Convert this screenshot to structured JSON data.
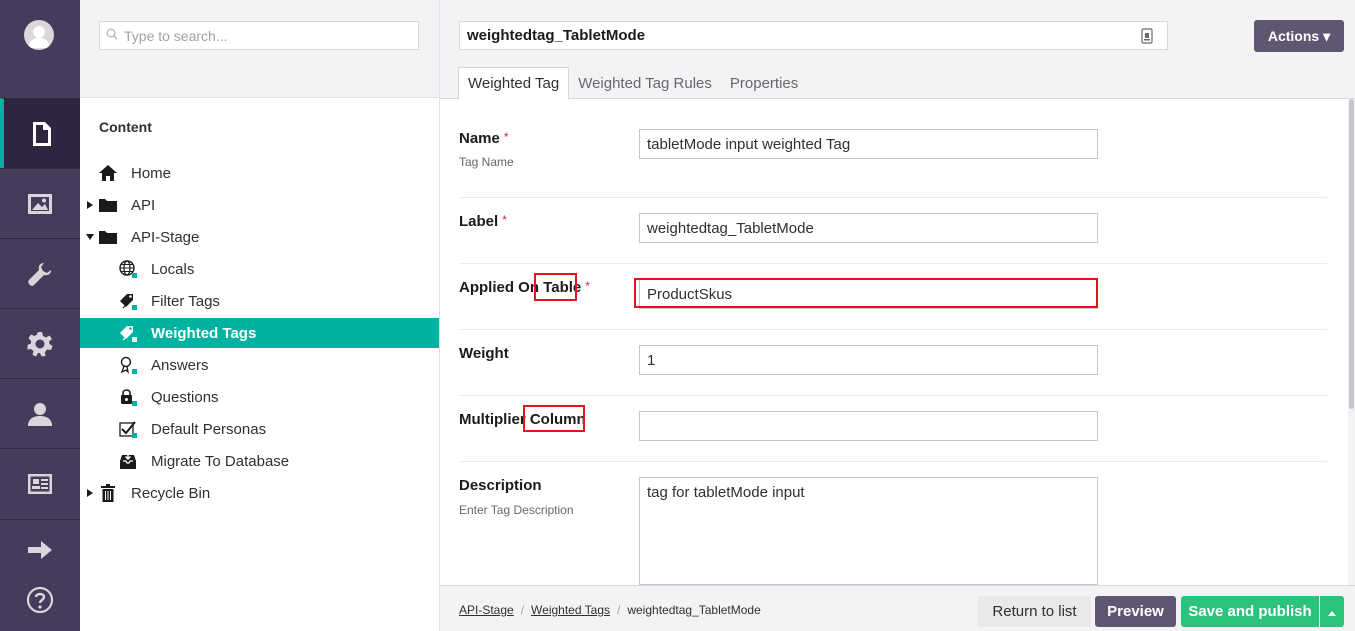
{
  "search": {
    "placeholder": "Type to search..."
  },
  "tree": {
    "heading": "Content",
    "nodes": [
      {
        "label": "Home",
        "icon": "home-icon"
      },
      {
        "label": "API",
        "icon": "folder-icon"
      },
      {
        "label": "API-Stage",
        "icon": "folder-icon"
      },
      {
        "label": "Locals",
        "icon": "globe-icon"
      },
      {
        "label": "Filter Tags",
        "icon": "tags-icon"
      },
      {
        "label": "Weighted Tags",
        "icon": "tags-icon"
      },
      {
        "label": "Answers",
        "icon": "answer-icon"
      },
      {
        "label": "Questions",
        "icon": "question-lock-icon"
      },
      {
        "label": "Default Personas",
        "icon": "checklist-icon"
      },
      {
        "label": "Migrate To Database",
        "icon": "inbox-download-icon"
      },
      {
        "label": "Recycle Bin",
        "icon": "trash-icon"
      }
    ]
  },
  "editor": {
    "node_name": "weightedtag_TabletMode",
    "actions_label": "Actions ▾",
    "tabs": [
      "Weighted Tag",
      "Weighted Tag Rules",
      "Properties"
    ],
    "fields": {
      "name": {
        "label": "Name",
        "required": "*",
        "description": "Tag Name",
        "value": "tabletMode input weighted Tag"
      },
      "label": {
        "label": "Label",
        "required": "*",
        "value": "weightedtag_TabletMode"
      },
      "applied": {
        "label_a": "Applied On",
        "label_b": "Table",
        "required": "*",
        "value": "ProductSkus"
      },
      "weight": {
        "label": "Weight",
        "value": "1"
      },
      "multiplier": {
        "label_a": "Multiplier",
        "label_b": "Column",
        "value": ""
      },
      "description": {
        "label": "Description",
        "description": "Enter Tag Description",
        "value": "tag for tabletMode input"
      }
    }
  },
  "footer": {
    "breadcrumb": [
      "API-Stage",
      "Weighted Tags",
      "weightedtag_TabletMode"
    ],
    "return_label": "Return to list",
    "preview_label": "Preview",
    "publish_label": "Save and publish"
  },
  "colors": {
    "rail": "#453b5a",
    "accent": "#00b2a2",
    "publish": "#2bc37c",
    "highlight": "#e0161e"
  }
}
